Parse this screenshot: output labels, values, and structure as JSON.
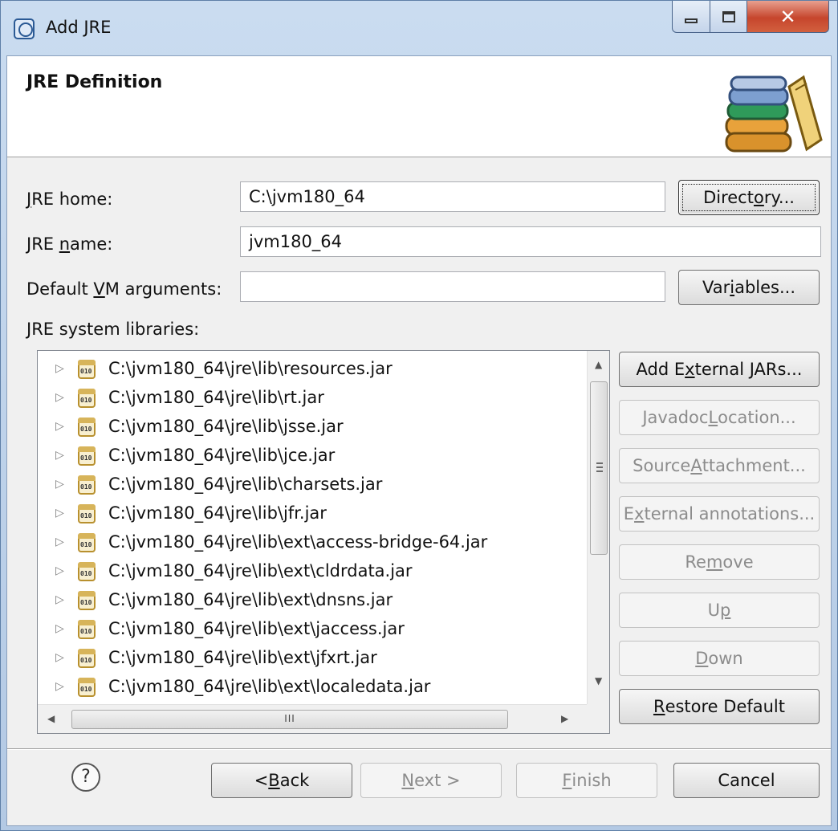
{
  "window": {
    "title": "Add JRE"
  },
  "header": {
    "title": "JRE Definition"
  },
  "form": {
    "jre_home_label_pre": "",
    "jre_home_label_u": "J",
    "jre_home_label_post": "RE home:",
    "jre_home_value": "C:\\jvm180_64",
    "jre_name_label_pre": "JRE ",
    "jre_name_label_u": "n",
    "jre_name_label_post": "ame:",
    "jre_name_value": "jvm180_64",
    "vm_args_label_pre": "Default ",
    "vm_args_label_u": "V",
    "vm_args_label_post": "M arguments:",
    "vm_args_value": "",
    "libraries_label": "JRE system libraries:"
  },
  "buttons": {
    "directory": {
      "pre": "Direct",
      "u": "o",
      "post": "ry..."
    },
    "variables": {
      "pre": "Var",
      "u": "i",
      "post": "ables..."
    },
    "add_external_jars": {
      "pre": "Add E",
      "u": "x",
      "post": "ternal JARs..."
    },
    "javadoc_location": {
      "pre": "Javadoc ",
      "u": "L",
      "post": "ocation..."
    },
    "source_attachment": {
      "pre": "Source ",
      "u": "A",
      "post": "ttachment..."
    },
    "external_annotations": {
      "pre": "E",
      "u": "x",
      "post": "ternal annotations..."
    },
    "remove": {
      "pre": "Re",
      "u": "m",
      "post": "ove"
    },
    "up": {
      "pre": "U",
      "u": "p",
      "post": ""
    },
    "down": {
      "pre": "",
      "u": "D",
      "post": "own"
    },
    "restore_default": {
      "pre": "",
      "u": "R",
      "post": "estore Default"
    }
  },
  "libraries": [
    "C:\\jvm180_64\\jre\\lib\\resources.jar",
    "C:\\jvm180_64\\jre\\lib\\rt.jar",
    "C:\\jvm180_64\\jre\\lib\\jsse.jar",
    "C:\\jvm180_64\\jre\\lib\\jce.jar",
    "C:\\jvm180_64\\jre\\lib\\charsets.jar",
    "C:\\jvm180_64\\jre\\lib\\jfr.jar",
    "C:\\jvm180_64\\jre\\lib\\ext\\access-bridge-64.jar",
    "C:\\jvm180_64\\jre\\lib\\ext\\cldrdata.jar",
    "C:\\jvm180_64\\jre\\lib\\ext\\dnsns.jar",
    "C:\\jvm180_64\\jre\\lib\\ext\\jaccess.jar",
    "C:\\jvm180_64\\jre\\lib\\ext\\jfxrt.jar",
    "C:\\jvm180_64\\jre\\lib\\ext\\localedata.jar"
  ],
  "footer": {
    "back": {
      "pre": "< ",
      "u": "B",
      "post": "ack"
    },
    "next": {
      "pre": "",
      "u": "N",
      "post": "ext >"
    },
    "finish": {
      "pre": "",
      "u": "F",
      "post": "inish"
    },
    "cancel": "Cancel",
    "help_glyph": "?"
  },
  "icons": {
    "app": "eclipse-icon",
    "header": "library-books-icon",
    "expander": "▷",
    "jar": "jar-file-icon"
  }
}
